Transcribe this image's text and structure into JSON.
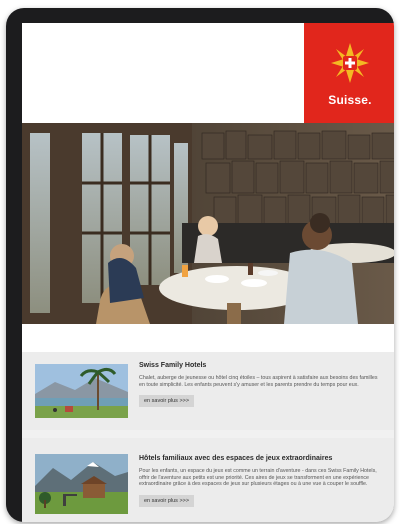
{
  "brand": {
    "name": "Suisse.",
    "accent_color": "#e1261c",
    "logo_icon": "swiss-star-cross-icon"
  },
  "hero": {
    "image_icon": "family-restaurant-photo"
  },
  "articles": [
    {
      "title": "Swiss Family Hotels",
      "text": "Chalet, auberge de jeunesse ou hôtel cinq étoiles – tous aspirent à satisfaire aux besoins des familles en toute simplicité. Les enfants peuvent s'y amuser et les parents prendre du temps pour eux.",
      "button": "en savoir plus >>>",
      "thumb_icon": "lake-palm-photo"
    },
    {
      "title": "Hôtels familiaux avec des espaces de jeux extraordinaires",
      "text": "Pour les enfants, un espace du jeux est comme un terrain d'aventure - dans ces Swiss Family Hotels, offrir de l'aventure aux petits est une priorité. Ces aires de jeux se transforment en une expérience extraordinaire grâce à des espaces de jeux sur plusieurs étages ou à une vue à couper le souffle.",
      "button": "en savoir plus >>>",
      "thumb_icon": "mountain-playground-photo"
    }
  ]
}
